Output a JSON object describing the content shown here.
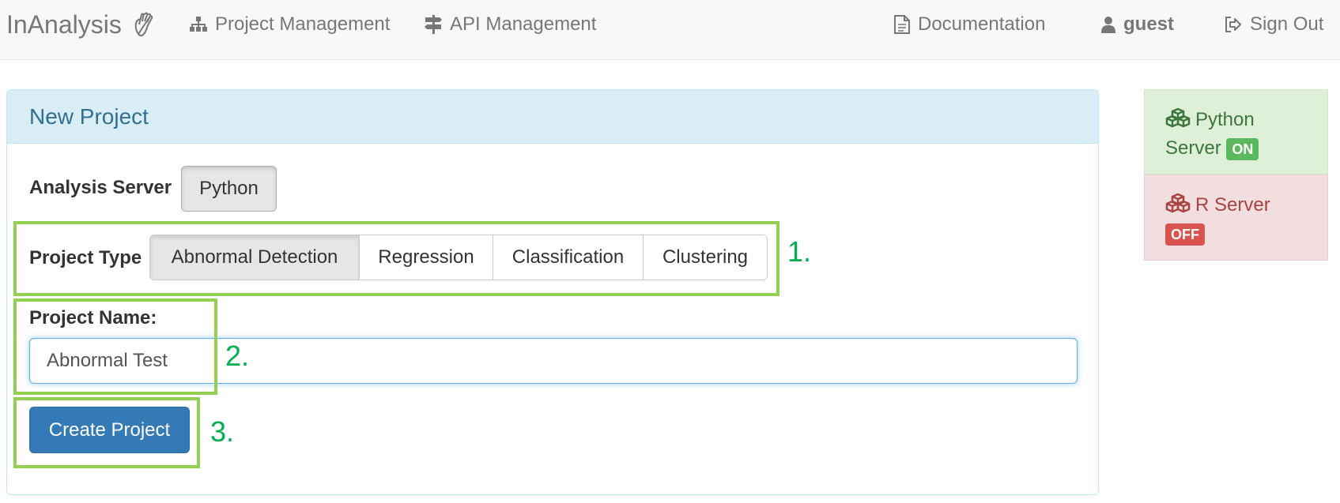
{
  "navbar": {
    "brand": "InAnalysis",
    "brand_icon": "waving-hand-icon",
    "items": [
      {
        "label": "Project Management",
        "icon": "sitemap-icon"
      },
      {
        "label": "API Management",
        "icon": "signpost-icon"
      },
      {
        "label": "Documentation",
        "icon": "document-icon"
      },
      {
        "label": "guest",
        "icon": "user-icon"
      },
      {
        "label": "Sign Out",
        "icon": "sign-out-icon"
      }
    ]
  },
  "panel": {
    "title": "New Project",
    "analysis_server_label": "Analysis Server",
    "analysis_server_value": "Python",
    "project_type_label": "Project Type",
    "project_types": [
      {
        "label": "Abnormal Detection",
        "active": true
      },
      {
        "label": "Regression",
        "active": false
      },
      {
        "label": "Classification",
        "active": false
      },
      {
        "label": "Clustering",
        "active": false
      }
    ],
    "project_name_label": "Project Name:",
    "project_name_value": "Abnormal Test",
    "create_button": "Create Project"
  },
  "annotations": {
    "step1": "1.",
    "step2": "2.",
    "step3": "3.",
    "highlight_color": "#92d050",
    "number_color": "#00b050"
  },
  "servers": [
    {
      "line1": "Python",
      "line2": "Server",
      "status": "ON",
      "status_color": "#5cb85c"
    },
    {
      "line1": "R Server",
      "status": "OFF",
      "status_color": "#d9534f"
    }
  ]
}
